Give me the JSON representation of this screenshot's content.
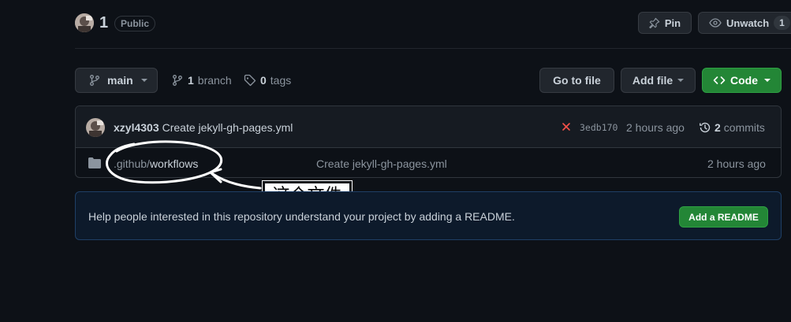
{
  "repo": {
    "name": "1",
    "visibility": "Public"
  },
  "header_actions": {
    "pin_label": "Pin",
    "unwatch_label": "Unwatch",
    "unwatch_count": "1"
  },
  "toolbar": {
    "branch_name": "main",
    "branch_count": "1",
    "branch_word": "branch",
    "tag_count": "0",
    "tag_word": "tags",
    "go_to_file": "Go to file",
    "add_file": "Add file",
    "code": "Code"
  },
  "commit": {
    "author": "xzyl4303",
    "message": "Create jekyll-gh-pages.yml",
    "status_icon": "x-icon",
    "hash": "3edb170",
    "time": "2 hours ago",
    "commit_count": "2",
    "commit_word": "commits"
  },
  "files": [
    {
      "icon": "folder-icon",
      "path_prefix": ".github/",
      "path_name": "workflows",
      "message": "Create jekyll-gh-pages.yml",
      "time": "2 hours ago"
    }
  ],
  "annotation": {
    "label": "这个文件"
  },
  "readme_banner": {
    "text": "Help people interested in this repository understand your project by adding a README.",
    "button": "Add a README"
  },
  "colors": {
    "accent_green": "#238636",
    "fail_red": "#f85149",
    "background": "#0d1117",
    "banner_bg": "#0d1a2b"
  }
}
